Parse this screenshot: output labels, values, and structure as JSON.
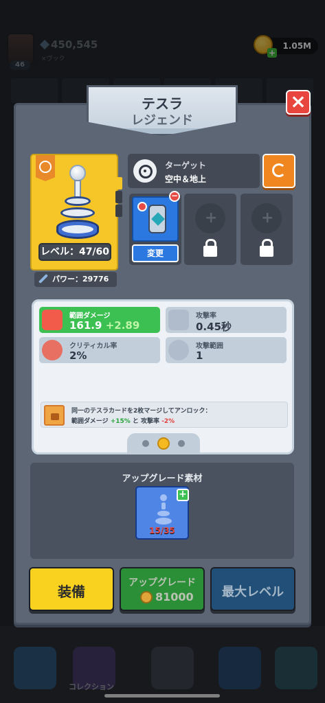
{
  "topbar": {
    "avatar_level": "46",
    "power": "450,545",
    "player_name": "×ヴック",
    "gems": "1.05M"
  },
  "bottom_nav": {
    "collection_label": "コレクション"
  },
  "modal": {
    "title": "テスラ",
    "rarity": "レジェンド",
    "close_icon": "×"
  },
  "card": {
    "level": "レベル：47/60",
    "power_label": "パワー：29776"
  },
  "target": {
    "title": "ターゲット",
    "value": "空中＆地上"
  },
  "slots": {
    "change_label": "変更",
    "remove_symbol": "−",
    "locked_plus": "+"
  },
  "stats": [
    {
      "label": "範囲ダメージ",
      "value": "161.9",
      "bonus": "+2.89",
      "highlight": true
    },
    {
      "label": "攻撃率",
      "value": "0.45秒"
    },
    {
      "label": "クリティカル率",
      "value": "2%"
    },
    {
      "label": "攻撃範囲",
      "value": "1"
    }
  ],
  "unlock": {
    "line1": "同一のテスラカードを2枚マージしてアンロック：",
    "line2_a": "範囲ダメージ ",
    "line2_b": "+15%",
    "line2_c": " と 攻撃率 ",
    "line2_d": "-2%"
  },
  "materials": {
    "title": "アップグレード素材",
    "count": "15/35",
    "plus": "+"
  },
  "buttons": {
    "equip": "装備",
    "upgrade": "アップグレード",
    "upgrade_cost": "81000",
    "max_level": "最大レベル"
  },
  "colors": {
    "accent_green": "#3cc052",
    "equip_yellow": "#f8d21e",
    "close_red": "#e8453f",
    "legend_yellow": "#f6c628"
  }
}
